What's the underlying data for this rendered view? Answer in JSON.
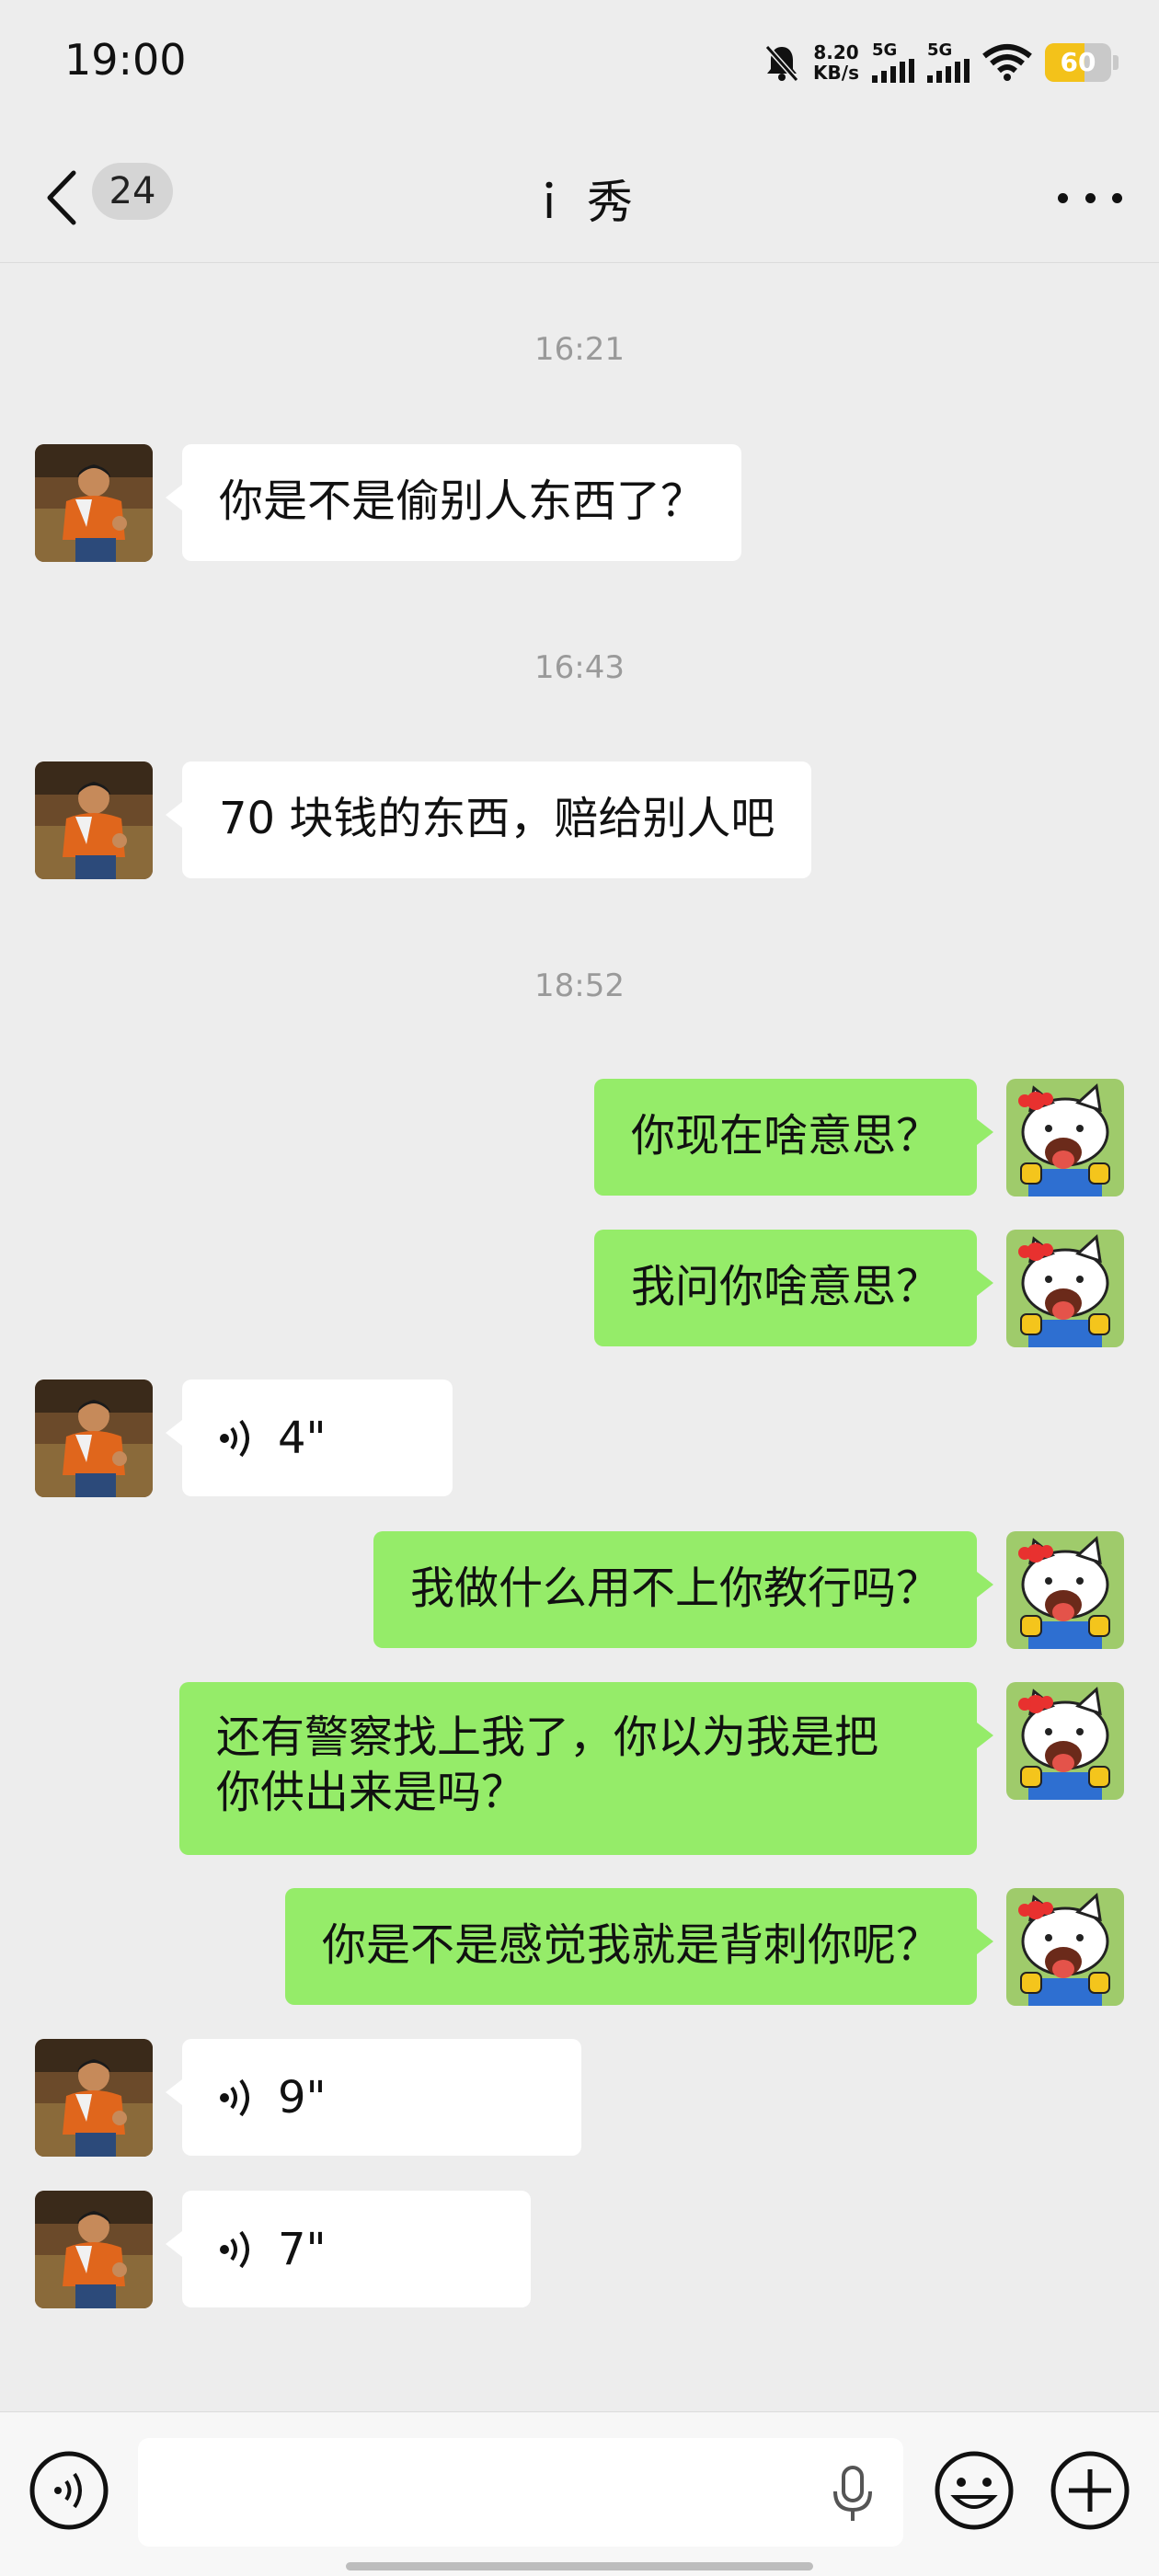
{
  "status_bar": {
    "time": "19:00",
    "speed_value": "8.20",
    "speed_unit": "KB/s",
    "network_1": "5G",
    "network_2": "5G",
    "battery": "60",
    "battery_level": 0.6,
    "icons": [
      "mute-bell-icon",
      "signal-icon",
      "signal-icon",
      "wifi-icon",
      "battery-icon"
    ]
  },
  "nav": {
    "unread_count": "24",
    "title": "ｉ 秀",
    "back_icon": "chevron-left-icon",
    "more_icon": "more-dots-icon"
  },
  "messages": [
    {
      "time": "16:21"
    },
    {
      "side": "in",
      "type": "text",
      "text": "你是不是偷别人东西了？"
    },
    {
      "time": "16:43"
    },
    {
      "side": "in",
      "type": "text",
      "text": "70 块钱的东西，赔给别人吧"
    },
    {
      "time": "18:52"
    },
    {
      "side": "out",
      "type": "text",
      "text": "你现在啥意思？"
    },
    {
      "side": "out",
      "type": "text",
      "text": "我问你啥意思？"
    },
    {
      "side": "in",
      "type": "voice",
      "duration": "4\""
    },
    {
      "side": "out",
      "type": "text",
      "text": "我做什么用不上你教行吗？"
    },
    {
      "side": "out",
      "type": "text",
      "text_line1": "还有警察找上我了，你以为我是把",
      "text_line2": "你供出来是吗？"
    },
    {
      "side": "out",
      "type": "text",
      "text": "你是不是感觉我就是背刺你呢？"
    },
    {
      "side": "in",
      "type": "voice",
      "duration": "9\""
    },
    {
      "side": "in",
      "type": "voice",
      "duration": "7\""
    }
  ],
  "input_bar": {
    "icons": [
      "voice-mode-icon",
      "microphone-icon",
      "emoji-icon",
      "plus-icon"
    ]
  },
  "colors": {
    "background": "#ededed",
    "outgoing_bubble": "#95ec69",
    "incoming_bubble": "#ffffff",
    "timestamp": "#9a9a9a",
    "battery": "#f3c21a"
  }
}
